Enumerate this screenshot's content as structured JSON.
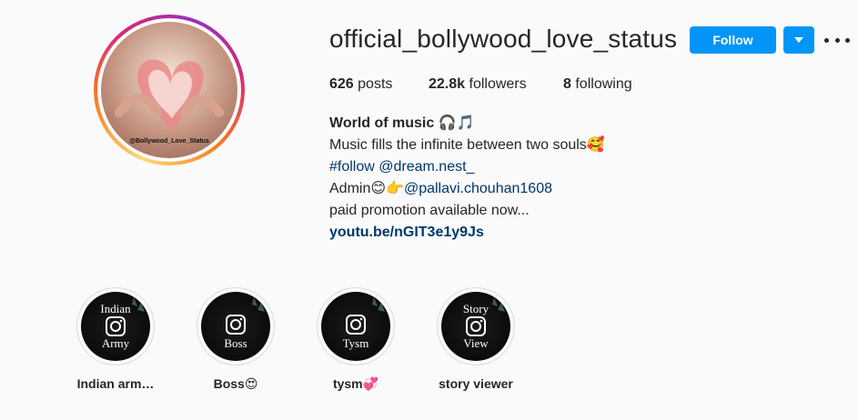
{
  "profile": {
    "username": "official_bollywood_love_status",
    "avatar_watermark": "@Bollywood_Love_Status",
    "follow_label": "Follow"
  },
  "stats": {
    "posts_count": "626",
    "posts_label": "posts",
    "followers_count": "22.8k",
    "followers_label": "followers",
    "following_count": "8",
    "following_label": "following"
  },
  "bio": {
    "name": "World of music 🎧🎵",
    "line1": "Music fills the infinite between two souls🥰",
    "hashtag": "#follow",
    "mention1": "@dream.nest_",
    "admin_prefix": "Admin😊👉",
    "mention2": "@pallavi.chouhan1608",
    "promo": "paid promotion available now...",
    "website": "youtu.be/nGIT3e1y9Js"
  },
  "highlights": [
    {
      "label": "Indian arm…",
      "cover_top": "Indian",
      "cover_bottom": "Army"
    },
    {
      "label": "Boss😍",
      "cover_top": "",
      "cover_bottom": "Boss"
    },
    {
      "label": "tysm💞",
      "cover_top": "",
      "cover_bottom": "Tysm"
    },
    {
      "label": "story viewer",
      "cover_top": "Story",
      "cover_bottom": "View"
    }
  ],
  "icons": {
    "more": "more-options-icon",
    "dropdown": "chevron-down-icon",
    "highlight_cover": "instagram-logo-icon"
  },
  "colors": {
    "primary_button": "#0095f6",
    "link": "#00376b",
    "text": "#262626",
    "background": "#fafafa"
  }
}
